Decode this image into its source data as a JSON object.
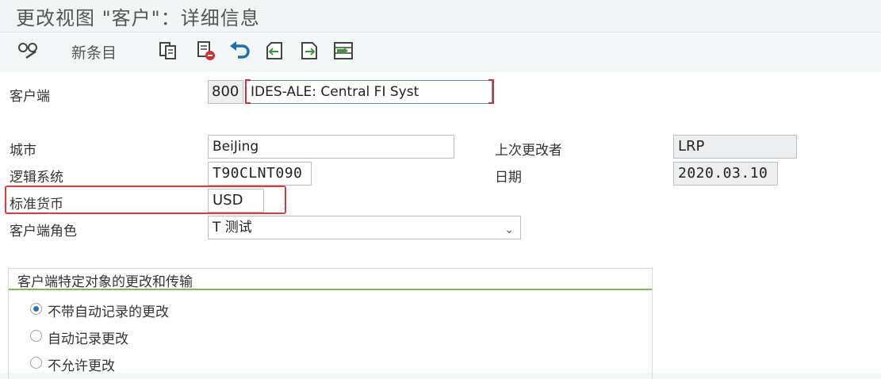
{
  "window": {
    "title": "更改视图 \"客户\"：详细信息"
  },
  "toolbar": {
    "new_entries_label": "新条目"
  },
  "form": {
    "client_label": "客户端",
    "client_number": "800",
    "client_name": "IDES-ALE: Central FI Syst",
    "city_label": "城市",
    "city_value": "BeiJing",
    "logical_system_label": "逻辑系统",
    "logical_system_value": "T90CLNT090",
    "currency_label": "标准货币",
    "currency_value": "USD",
    "role_label": "客户端角色",
    "role_value": "T 测试",
    "last_changed_by_label": "上次更改者",
    "last_changed_by_value": "LRP",
    "date_label": "日期",
    "date_value": "2020.03.10"
  },
  "group": {
    "title": "客户端特定对象的更改和传输",
    "options": [
      {
        "label": "不带自动记录的更改",
        "selected": true
      },
      {
        "label": "自动记录更改",
        "selected": false
      },
      {
        "label": "不允许更改",
        "selected": false
      }
    ]
  },
  "colors": {
    "highlight": "#e03b3b",
    "group_rule": "#6fbf5a",
    "accent": "#2c6fb5"
  }
}
